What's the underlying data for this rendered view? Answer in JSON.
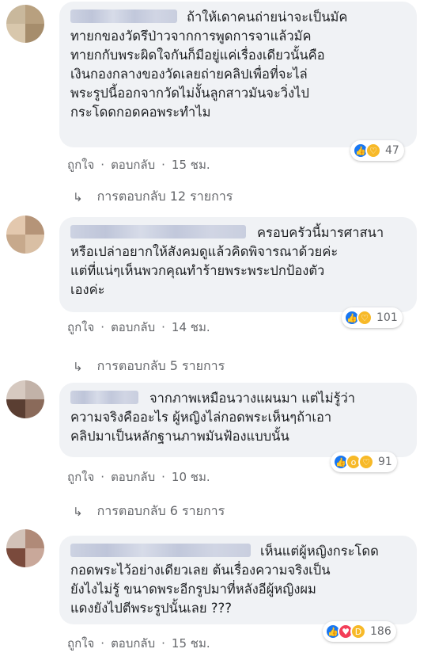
{
  "comments": [
    {
      "text": "ถ้าให้เดาคนถ่ายน่าจะเป็นมัค\nทายกของวัดรึป่าวจากการพูดการจาแล้วมัค\nทายกกับพระผิดใจกันก็มีอยู่แค่เรื่องเดียวนั้นคือ\nเงินกองกลางของวัดเลยถ่ายคลิปเพื่อที่จะไล่\nพระรูปนี้ออกจากวัดไม่งั้นลูกสาวมันจะวิ่งไป\nกระโดดกอดคอพระทำไม",
      "reactions": [
        "like-icon",
        "care-icon"
      ],
      "reaction_count": "47",
      "like_label": "ถูกใจ",
      "reply_label": "ตอบกลับ",
      "time": "15 ชม.",
      "replies_label": "การตอบกลับ 12 รายการ"
    },
    {
      "text": "ครอบครัวนี้มารศาสนา\nหรือเปล่าอยากให้สังคมดูแล้วคิดพิจารณาด้วยค่ะ\nแต่ที่แน่ๆเห็นพวกคุณทำร้ายพระพระปกป้องตัว\nเองค่ะ",
      "reactions": [
        "like-icon",
        "care-icon"
      ],
      "reaction_count": "101",
      "like_label": "ถูกใจ",
      "reply_label": "ตอบกลับ",
      "time": "14 ชม.",
      "replies_label": "การตอบกลับ 5 รายการ"
    },
    {
      "text": "จากภาพเหมือนวางแผนมา แต่ไม่รู้ว่า\nความจริงคืออะไร ผู้หญิงไล่กอดพระเห็นๆถ้าเอา\nคลิปมาเป็นหลักฐานภาพมันฟ้องแบบนั้น",
      "reactions": [
        "like-icon",
        "wow-icon",
        "care-icon"
      ],
      "reaction_count": "91",
      "like_label": "ถูกใจ",
      "reply_label": "ตอบกลับ",
      "time": "10 ชม.",
      "replies_label": "การตอบกลับ 6 รายการ"
    },
    {
      "text": "เห็นแต่ผู้หญิงกระโดด\nกอดพระไว้อย่างเดียวเลย ต้นเรื่องความจริงเป็น\nยังไงไม่รู้ ขนาดพระอีกรูปมาที่หลังอีผู้หญิงผม\nแดงยังไปตีพระรูปนั้นเลย ???",
      "reactions": [
        "like-icon",
        "love-icon",
        "haha-icon"
      ],
      "reaction_count": "186",
      "like_label": "ถูกใจ",
      "reply_label": "ตอบกลับ",
      "time": "15 ชม."
    }
  ],
  "colors": {
    "bubble": "#f0f2f5",
    "meta": "#65676b",
    "like": "#1877f2",
    "love": "#f33e58",
    "yellow": "#f7b928"
  }
}
